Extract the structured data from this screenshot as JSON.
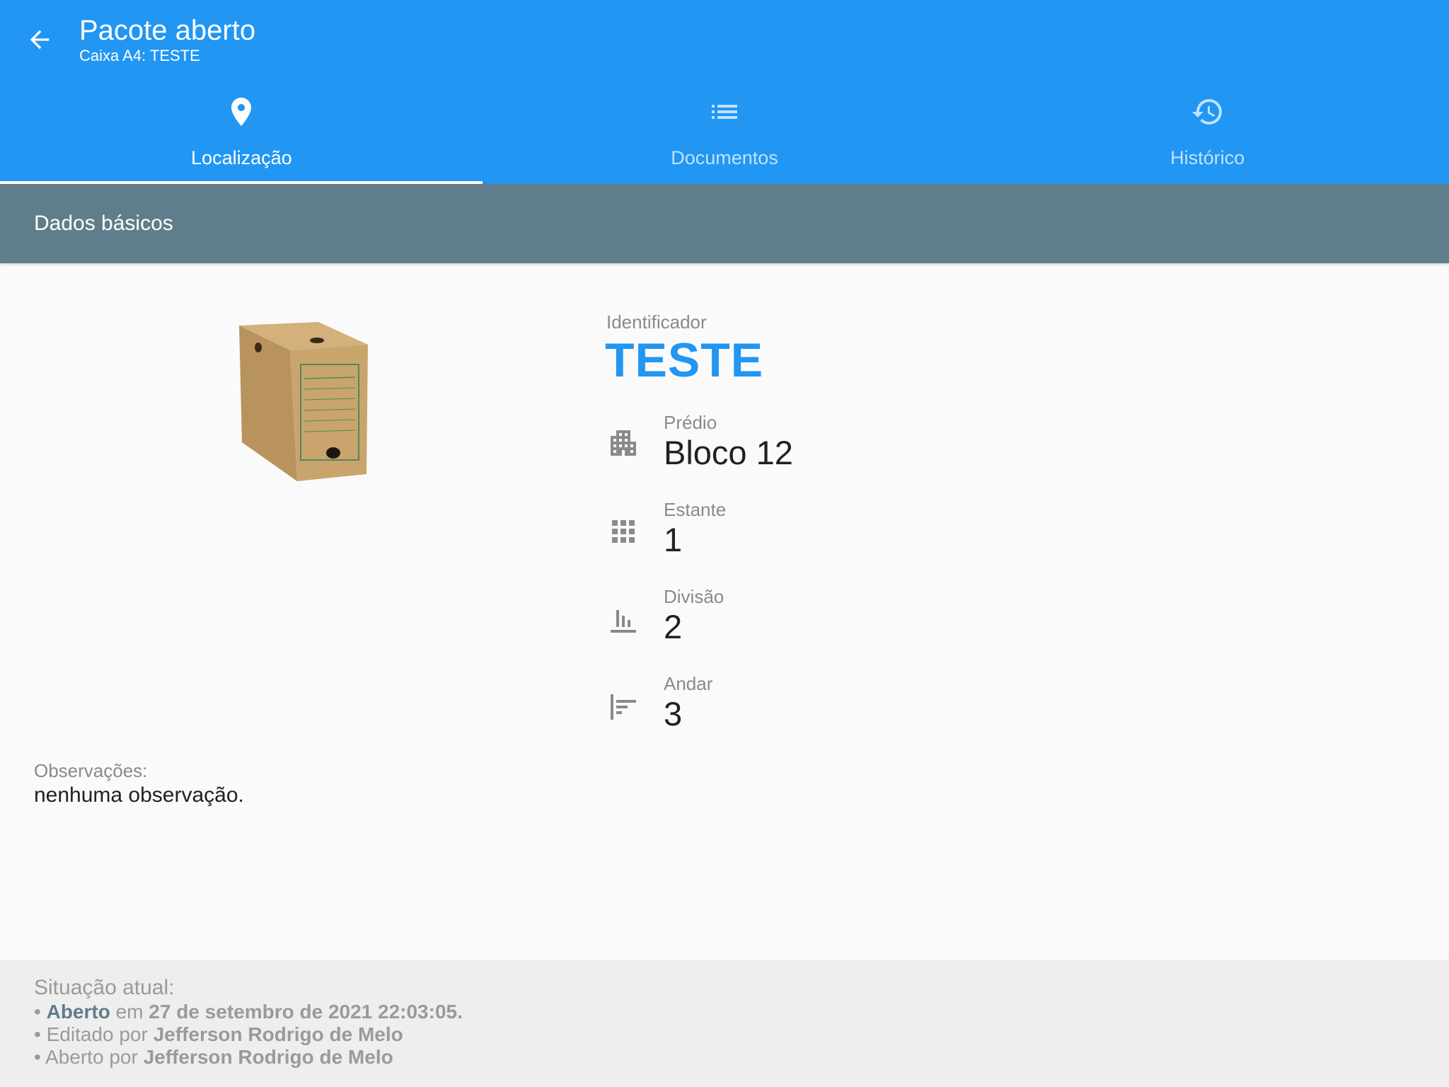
{
  "appbar": {
    "title": "Pacote aberto",
    "subtitle": "Caixa A4: TESTE"
  },
  "tabs": [
    {
      "label": "Localização",
      "icon": "location-pin-icon",
      "active": true
    },
    {
      "label": "Documentos",
      "icon": "list-icon",
      "active": false
    },
    {
      "label": "Histórico",
      "icon": "history-icon",
      "active": false
    }
  ],
  "section": {
    "title": "Dados básicos"
  },
  "identifier": {
    "label": "Identificador",
    "value": "TESTE"
  },
  "fields": [
    {
      "label": "Prédio",
      "value": "Bloco 12",
      "icon": "building-icon"
    },
    {
      "label": "Estante",
      "value": "1",
      "icon": "grid-icon"
    },
    {
      "label": "Divisão",
      "value": "2",
      "icon": "bar-chart-icon"
    },
    {
      "label": "Andar",
      "value": "3",
      "icon": "align-left-icon"
    }
  ],
  "observations": {
    "label": "Observações:",
    "value": "nenhuma observação."
  },
  "footer": {
    "title": "Situação atual:",
    "line1": {
      "bullet": "• ",
      "status": "Aberto",
      "connector": " em ",
      "date": "27 de setembro de 2021 22:03:05."
    },
    "line2": {
      "prefix": "• Editado por ",
      "name": "Jefferson Rodrigo de Melo"
    },
    "line3": {
      "prefix": "• Aberto por ",
      "name": "Jefferson Rodrigo de Melo"
    }
  },
  "colors": {
    "primary": "#2196f3",
    "section": "#607d8b",
    "footer_bg": "#eeeeee"
  }
}
